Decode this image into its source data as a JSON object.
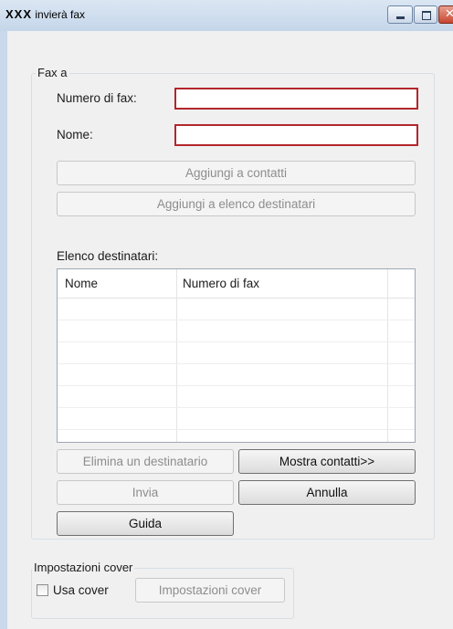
{
  "window": {
    "title_prefix": "XXX",
    "title": "invierà fax",
    "controls": {
      "minimize": "minimize",
      "maximize": "maximize",
      "close": "close"
    }
  },
  "fax_group": {
    "legend": "Fax a",
    "number_label": "Numero di fax:",
    "number_value": "",
    "name_label": "Nome:",
    "name_value": "",
    "add_contacts_button": "Aggiungi a contatti",
    "add_recipients_button": "Aggiungi a elenco destinatari",
    "recipients_label": "Elenco destinatari:",
    "recipients_table": {
      "columns": [
        "Nome",
        "Numero di fax"
      ],
      "rows": []
    },
    "delete_recipient_button": "Elimina un destinatario",
    "show_contacts_button": "Mostra contatti>>",
    "send_button": "Invia",
    "cancel_button": "Annulla",
    "help_button": "Guida"
  },
  "cover_group": {
    "legend": "Impostazioni cover",
    "use_cover_label": "Usa cover",
    "use_cover_checked": false,
    "cover_settings_button": "Impostazioni cover"
  },
  "colors": {
    "invalid_field_border": "#b3262c",
    "window_frame": "#c9d8ea",
    "dialog_background": "#f0f0f0"
  }
}
